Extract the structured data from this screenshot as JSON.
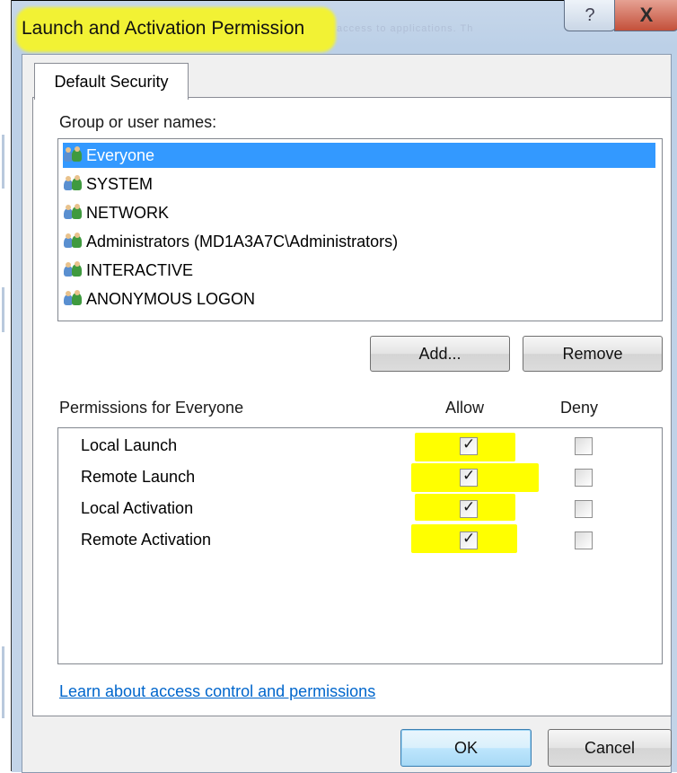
{
  "window": {
    "title": "Launch and Activation Permission",
    "faded_background_text": "access to applications. Th",
    "help_glyph": "?",
    "close_glyph": "X"
  },
  "tabs": [
    {
      "label": "Default Security",
      "selected": true
    }
  ],
  "groups": {
    "label": "Group or user names:",
    "items": [
      {
        "name": "Everyone",
        "selected": true,
        "icon": "users-icon"
      },
      {
        "name": "SYSTEM",
        "selected": false,
        "icon": "users-icon"
      },
      {
        "name": "NETWORK",
        "selected": false,
        "icon": "users-icon"
      },
      {
        "name": "Administrators (MD1A3A7C\\Administrators)",
        "selected": false,
        "icon": "users-icon"
      },
      {
        "name": "INTERACTIVE",
        "selected": false,
        "icon": "users-icon"
      },
      {
        "name": "ANONYMOUS LOGON",
        "selected": false,
        "icon": "users-icon"
      }
    ]
  },
  "group_buttons": {
    "add": "Add...",
    "remove": "Remove"
  },
  "permissions": {
    "label": "Permissions for Everyone",
    "allow_header": "Allow",
    "deny_header": "Deny",
    "rows": [
      {
        "name": "Local Launch",
        "allow": true,
        "deny": false
      },
      {
        "name": "Remote Launch",
        "allow": true,
        "deny": false
      },
      {
        "name": "Local Activation",
        "allow": true,
        "deny": false
      },
      {
        "name": "Remote Activation",
        "allow": true,
        "deny": false
      }
    ]
  },
  "link": {
    "text": "Learn about access control and permissions"
  },
  "footer": {
    "ok": "OK",
    "cancel": "Cancel"
  },
  "colors": {
    "highlight": "#ffff00",
    "selection": "#3399ff",
    "link": "#0066cc"
  }
}
